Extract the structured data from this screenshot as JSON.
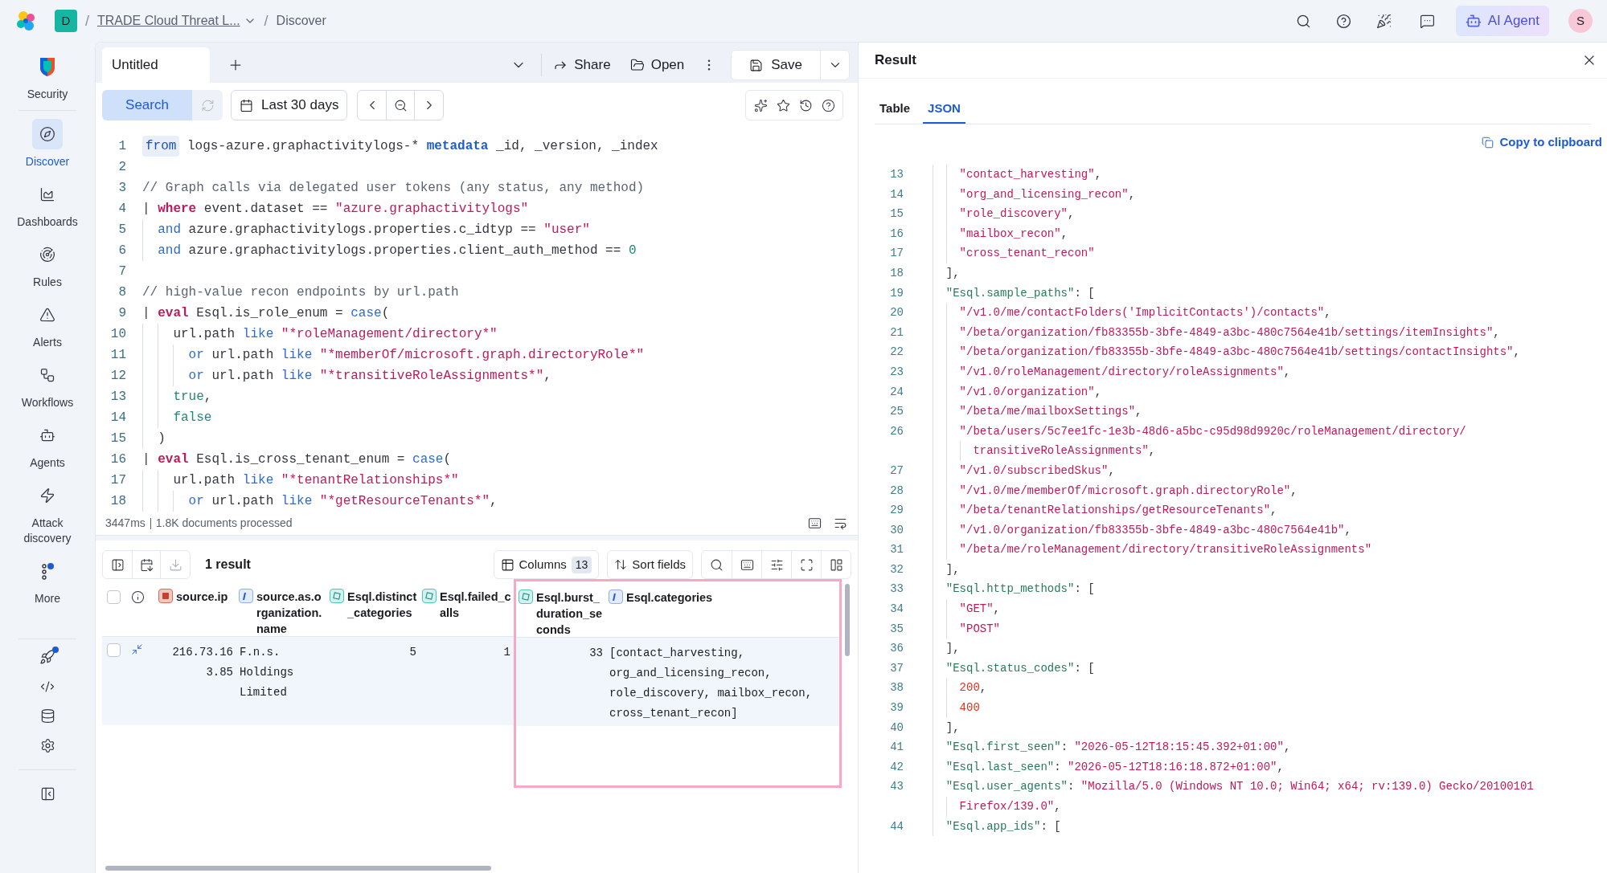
{
  "header": {
    "space_badge": "D",
    "breadcrumbs": [
      {
        "separator": "/",
        "text": "TRADE Cloud Threat L...",
        "kind": "link"
      },
      {
        "separator": "/",
        "text": "Discover",
        "kind": "current"
      }
    ],
    "ai_button": "AI Agent",
    "avatar": "S"
  },
  "sidebar": {
    "items": [
      {
        "label": "Security",
        "selected": false
      },
      {
        "label": "Discover",
        "selected": true
      },
      {
        "label": "Dashboards",
        "selected": false
      },
      {
        "label": "Rules",
        "selected": false
      },
      {
        "label": "Alerts",
        "selected": false
      },
      {
        "label": "Workflows",
        "selected": false
      },
      {
        "label": "Agents",
        "selected": false
      },
      {
        "label": "Attack discovery",
        "selected": false
      },
      {
        "label": "More",
        "selected": false
      }
    ]
  },
  "editor": {
    "tabs": [
      {
        "label": "Untitled",
        "selected": true
      }
    ],
    "share": "Share",
    "open": "Open",
    "save": "Save",
    "search_button": "Search",
    "date_range": "Last 30 days",
    "lines": [
      {
        "n": "1",
        "tokens": [
          {
            "kind": "command",
            "text": "from"
          },
          {
            "kind": "plain",
            "text": " logs-azure.graphactivitylogs-* "
          },
          {
            "kind": "meta",
            "text": "metadata"
          },
          {
            "kind": "plain",
            "text": " _id, _version, _index"
          }
        ]
      },
      {
        "n": "2"
      },
      {
        "n": "3",
        "tokens": [
          {
            "kind": "comment",
            "text": "// Graph calls via delegated user tokens (any status, any method)"
          }
        ]
      },
      {
        "n": "4",
        "tokens": [
          {
            "kind": "plain",
            "text": "| "
          },
          {
            "kind": "keyword",
            "text": "where"
          },
          {
            "kind": "plain",
            "text": " event.dataset == "
          },
          {
            "kind": "string",
            "text": "\"azure.graphactivitylogs\""
          }
        ]
      },
      {
        "n": "5",
        "tokens": [
          {
            "kind": "operator",
            "text": "  and"
          },
          {
            "kind": "plain",
            "text": " azure.graphactivitylogs.properties.c_idtyp == "
          },
          {
            "kind": "string",
            "text": "\"user\""
          }
        ]
      },
      {
        "n": "6",
        "tokens": [
          {
            "kind": "operator",
            "text": "  and"
          },
          {
            "kind": "plain",
            "text": " azure.graphactivitylogs.properties.client_auth_method == "
          },
          {
            "kind": "literal",
            "text": "0"
          }
        ]
      },
      {
        "n": "7"
      },
      {
        "n": "8",
        "tokens": [
          {
            "kind": "comment",
            "text": "// high-value recon endpoints by url.path"
          }
        ]
      },
      {
        "n": "9",
        "tokens": [
          {
            "kind": "plain",
            "text": "| "
          },
          {
            "kind": "keyword",
            "text": "eval"
          },
          {
            "kind": "plain",
            "text": " Esql.is_role_enum = "
          },
          {
            "kind": "operator",
            "text": "case"
          },
          {
            "kind": "plain",
            "text": "("
          }
        ]
      },
      {
        "n": "10",
        "tokens": [
          {
            "kind": "plain",
            "text": "    url.path "
          },
          {
            "kind": "operator",
            "text": "like"
          },
          {
            "kind": "string",
            "text": " \"*roleManagement/directory*\""
          }
        ]
      },
      {
        "n": "11",
        "tokens": [
          {
            "kind": "operator",
            "text": "      or"
          },
          {
            "kind": "plain",
            "text": " url.path "
          },
          {
            "kind": "operator",
            "text": "like"
          },
          {
            "kind": "string",
            "text": " \"*memberOf/microsoft.graph.directoryRole*\""
          }
        ]
      },
      {
        "n": "12",
        "tokens": [
          {
            "kind": "operator",
            "text": "      or"
          },
          {
            "kind": "plain",
            "text": " url.path "
          },
          {
            "kind": "operator",
            "text": "like"
          },
          {
            "kind": "string",
            "text": " \"*transitiveRoleAssignments*\""
          },
          {
            "kind": "plain",
            "text": ","
          }
        ]
      },
      {
        "n": "13",
        "tokens": [
          {
            "kind": "literal",
            "text": "    true"
          },
          {
            "kind": "plain",
            "text": ","
          }
        ]
      },
      {
        "n": "14",
        "tokens": [
          {
            "kind": "literal",
            "text": "    false"
          }
        ]
      },
      {
        "n": "15",
        "tokens": [
          {
            "kind": "plain",
            "text": "  )"
          }
        ]
      },
      {
        "n": "16",
        "tokens": [
          {
            "kind": "plain",
            "text": "| "
          },
          {
            "kind": "keyword",
            "text": "eval"
          },
          {
            "kind": "plain",
            "text": " Esql.is_cross_tenant_enum = "
          },
          {
            "kind": "operator",
            "text": "case"
          },
          {
            "kind": "plain",
            "text": "("
          }
        ]
      },
      {
        "n": "17",
        "tokens": [
          {
            "kind": "plain",
            "text": "    url.path "
          },
          {
            "kind": "operator",
            "text": "like"
          },
          {
            "kind": "string",
            "text": " \"*tenantRelationships*\""
          }
        ]
      },
      {
        "n": "18",
        "tokens": [
          {
            "kind": "operator",
            "text": "      or"
          },
          {
            "kind": "plain",
            "text": " url.path "
          },
          {
            "kind": "operator",
            "text": "like"
          },
          {
            "kind": "string",
            "text": " \"*getResourceTenants*\""
          },
          {
            "kind": "plain",
            "text": ","
          }
        ]
      }
    ],
    "status": {
      "duration": "3447ms",
      "documents": "1.8K documents processed"
    }
  },
  "results": {
    "select_all": {
      "checked": false
    },
    "count": "1 result",
    "columns_button": "Columns",
    "columns_count": "13",
    "sort_button": "Sort fields",
    "columns": [
      {
        "label": "source.ip",
        "kind": "ip",
        "highlighted": false
      },
      {
        "label": "source.as.organization.name",
        "kind": "keyword",
        "highlighted": false
      },
      {
        "label": "Esql.distinct_categories",
        "kind": "number",
        "highlighted": false
      },
      {
        "label": "Esql.failed_calls",
        "kind": "number",
        "highlighted": false
      },
      {
        "label": "Esql.burst_duration_seconds",
        "kind": "number",
        "highlighted": true
      },
      {
        "label": "Esql.categories",
        "kind": "keyword",
        "highlighted": true
      }
    ],
    "rows": [
      {
        "selected": false,
        "cells": [
          "216.73.163.85",
          "F.n.s. Holdings Limited",
          "5",
          "1",
          "33",
          "[contact_harvesting, org_and_licensing_recon, role_discovery, mailbox_recon, cross_tenant_recon]"
        ]
      }
    ]
  },
  "result_panel": {
    "title": "Result",
    "tabs": [
      {
        "label": "Table",
        "selected": false
      },
      {
        "label": "JSON",
        "selected": true
      }
    ],
    "copy_button": "Copy to clipboard",
    "lines": [
      {
        "n": "13",
        "tokens": [
          {
            "kind": "string",
            "text": "    \"contact_harvesting\""
          },
          {
            "kind": "punct",
            "text": ","
          }
        ]
      },
      {
        "n": "14",
        "tokens": [
          {
            "kind": "string",
            "text": "    \"org_and_licensing_recon\""
          },
          {
            "kind": "punct",
            "text": ","
          }
        ]
      },
      {
        "n": "15",
        "tokens": [
          {
            "kind": "string",
            "text": "    \"role_discovery\""
          },
          {
            "kind": "punct",
            "text": ","
          }
        ]
      },
      {
        "n": "16",
        "tokens": [
          {
            "kind": "string",
            "text": "    \"mailbox_recon\""
          },
          {
            "kind": "punct",
            "text": ","
          }
        ]
      },
      {
        "n": "17",
        "tokens": [
          {
            "kind": "string",
            "text": "    \"cross_tenant_recon\""
          }
        ]
      },
      {
        "n": "18",
        "tokens": [
          {
            "kind": "punct",
            "text": "  ],"
          }
        ]
      },
      {
        "n": "19",
        "tokens": [
          {
            "kind": "key",
            "text": "  \"Esql.sample_paths\""
          },
          {
            "kind": "punct",
            "text": ": ["
          }
        ]
      },
      {
        "n": "20",
        "tokens": [
          {
            "kind": "string",
            "text": "    \"/v1.0/me/contactFolders('ImplicitContacts')/contacts\""
          },
          {
            "kind": "punct",
            "text": ","
          }
        ]
      },
      {
        "n": "21",
        "tokens": [
          {
            "kind": "string",
            "text": "    \"/beta/organization/fb83355b-3bfe-4849-a3bc-480c7564e41b/settings/itemInsights\""
          },
          {
            "kind": "punct",
            "text": ","
          }
        ]
      },
      {
        "n": "22",
        "tokens": [
          {
            "kind": "string",
            "text": "    \"/beta/organization/fb83355b-3bfe-4849-a3bc-480c7564e41b/settings/contactInsights\""
          },
          {
            "kind": "punct",
            "text": ","
          }
        ]
      },
      {
        "n": "23",
        "tokens": [
          {
            "kind": "string",
            "text": "    \"/v1.0/roleManagement/directory/roleAssignments\""
          },
          {
            "kind": "punct",
            "text": ","
          }
        ]
      },
      {
        "n": "24",
        "tokens": [
          {
            "kind": "string",
            "text": "    \"/v1.0/organization\""
          },
          {
            "kind": "punct",
            "text": ","
          }
        ]
      },
      {
        "n": "25",
        "tokens": [
          {
            "kind": "string",
            "text": "    \"/beta/me/mailboxSettings\""
          },
          {
            "kind": "punct",
            "text": ","
          }
        ]
      },
      {
        "n": "26",
        "tokens": [
          {
            "kind": "string",
            "text": "    \"/beta/users/5c7ee1fc-1e3b-48d6-a5bc-c95d98d9920c/roleManagement/directory/"
          }
        ],
        "continued": [
          {
            "kind": "string",
            "text": "      transitiveRoleAssignments\""
          },
          {
            "kind": "punct",
            "text": ","
          }
        ]
      },
      {
        "n": "27",
        "tokens": [
          {
            "kind": "string",
            "text": "    \"/v1.0/subscribedSkus\""
          },
          {
            "kind": "punct",
            "text": ","
          }
        ]
      },
      {
        "n": "28",
        "tokens": [
          {
            "kind": "string",
            "text": "    \"/v1.0/me/memberOf/microsoft.graph.directoryRole\""
          },
          {
            "kind": "punct",
            "text": ","
          }
        ]
      },
      {
        "n": "29",
        "tokens": [
          {
            "kind": "string",
            "text": "    \"/beta/tenantRelationships/getResourceTenants\""
          },
          {
            "kind": "punct",
            "text": ","
          }
        ]
      },
      {
        "n": "30",
        "tokens": [
          {
            "kind": "string",
            "text": "    \"/v1.0/organization/fb83355b-3bfe-4849-a3bc-480c7564e41b\""
          },
          {
            "kind": "punct",
            "text": ","
          }
        ]
      },
      {
        "n": "31",
        "tokens": [
          {
            "kind": "string",
            "text": "    \"/beta/me/roleManagement/directory/transitiveRoleAssignments\""
          }
        ]
      },
      {
        "n": "32",
        "tokens": [
          {
            "kind": "punct",
            "text": "  ],"
          }
        ]
      },
      {
        "n": "33",
        "tokens": [
          {
            "kind": "key",
            "text": "  \"Esql.http_methods\""
          },
          {
            "kind": "punct",
            "text": ": ["
          }
        ]
      },
      {
        "n": "34",
        "tokens": [
          {
            "kind": "string",
            "text": "    \"GET\""
          },
          {
            "kind": "punct",
            "text": ","
          }
        ]
      },
      {
        "n": "35",
        "tokens": [
          {
            "kind": "string",
            "text": "    \"POST\""
          }
        ]
      },
      {
        "n": "36",
        "tokens": [
          {
            "kind": "punct",
            "text": "  ],"
          }
        ]
      },
      {
        "n": "37",
        "tokens": [
          {
            "kind": "key",
            "text": "  \"Esql.status_codes\""
          },
          {
            "kind": "punct",
            "text": ": ["
          }
        ]
      },
      {
        "n": "38",
        "tokens": [
          {
            "kind": "number",
            "text": "    200"
          },
          {
            "kind": "punct",
            "text": ","
          }
        ]
      },
      {
        "n": "39",
        "tokens": [
          {
            "kind": "number",
            "text": "    400"
          }
        ]
      },
      {
        "n": "40",
        "tokens": [
          {
            "kind": "punct",
            "text": "  ],"
          }
        ]
      },
      {
        "n": "41",
        "tokens": [
          {
            "kind": "key",
            "text": "  \"Esql.first_seen\""
          },
          {
            "kind": "punct",
            "text": ": "
          },
          {
            "kind": "string",
            "text": "\"2026-05-12T18:15:45.392+01:00\""
          },
          {
            "kind": "punct",
            "text": ","
          }
        ]
      },
      {
        "n": "42",
        "tokens": [
          {
            "kind": "key",
            "text": "  \"Esql.last_seen\""
          },
          {
            "kind": "punct",
            "text": ": "
          },
          {
            "kind": "string",
            "text": "\"2026-05-12T18:16:18.872+01:00\""
          },
          {
            "kind": "punct",
            "text": ","
          }
        ]
      },
      {
        "n": "43",
        "tokens": [
          {
            "kind": "key",
            "text": "  \"Esql.user_agents\""
          },
          {
            "kind": "punct",
            "text": ": "
          },
          {
            "kind": "string",
            "text": "\"Mozilla/5.0 (Windows NT 10.0; Win64; x64; rv:139.0) Gecko/20100101"
          }
        ],
        "continued": [
          {
            "kind": "string",
            "text": "    Firefox/139.0\""
          },
          {
            "kind": "punct",
            "text": ","
          }
        ]
      },
      {
        "n": "44",
        "tokens": [
          {
            "kind": "key",
            "text": "  \"Esql.app_ids\""
          },
          {
            "kind": "punct",
            "text": ": ["
          }
        ]
      }
    ]
  }
}
